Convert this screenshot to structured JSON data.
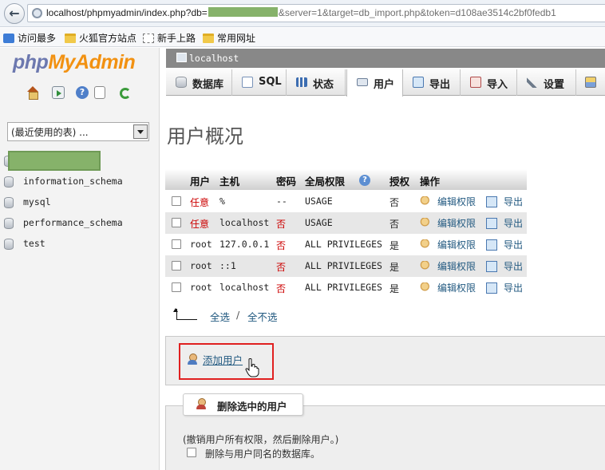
{
  "browser": {
    "url_visible_prefix": "localhost/phpmyadmin/index.php?db=",
    "url_visible_suffix": "&server=1&target=db_import.php&token=d108ae3514c2bf0fedb1",
    "bookmarks": [
      "访问最多",
      "火狐官方站点",
      "新手上路",
      "常用网址"
    ]
  },
  "nav": {
    "logo_part1": "php",
    "logo_part2": "MyAdmin",
    "db_select_value": "(最近使用的表) ...",
    "databases": [
      "information_schema",
      "mysql",
      "performance_schema",
      "test"
    ]
  },
  "server": {
    "label": "localhost"
  },
  "tabs": [
    {
      "label": "数据库"
    },
    {
      "label": "SQL"
    },
    {
      "label": "状态"
    },
    {
      "label": "用户"
    },
    {
      "label": "导出"
    },
    {
      "label": "导入"
    },
    {
      "label": "设置"
    }
  ],
  "page": {
    "title": "用户概况"
  },
  "table": {
    "headers": {
      "user": "用户",
      "host": "主机",
      "password": "密码",
      "privileges": "全局权限",
      "grant": "授权",
      "action": "操作"
    },
    "rows": [
      {
        "user": "任意",
        "host": "%",
        "password": "--",
        "privileges": "USAGE",
        "grant": "否",
        "edit": "编辑权限",
        "export": "导出"
      },
      {
        "user": "任意",
        "host": "localhost",
        "password": "否",
        "privileges": "USAGE",
        "grant": "否",
        "edit": "编辑权限",
        "export": "导出"
      },
      {
        "user": "root",
        "host": "127.0.0.1",
        "password": "否",
        "privileges": "ALL PRIVILEGES",
        "grant": "是",
        "edit": "编辑权限",
        "export": "导出"
      },
      {
        "user": "root",
        "host": "::1",
        "password": "否",
        "privileges": "ALL PRIVILEGES",
        "grant": "是",
        "edit": "编辑权限",
        "export": "导出"
      },
      {
        "user": "root",
        "host": "localhost",
        "password": "否",
        "privileges": "ALL PRIVILEGES",
        "grant": "是",
        "edit": "编辑权限",
        "export": "导出"
      }
    ],
    "select_all": "全选",
    "separator": "/",
    "select_none": "全不选"
  },
  "add_user": {
    "label": "添加用户"
  },
  "delete_users": {
    "legend": "删除选中的用户",
    "note": "(撤销用户所有权限，然后删除用户。)",
    "checkbox_label": "删除与用户同名的数据库。"
  }
}
